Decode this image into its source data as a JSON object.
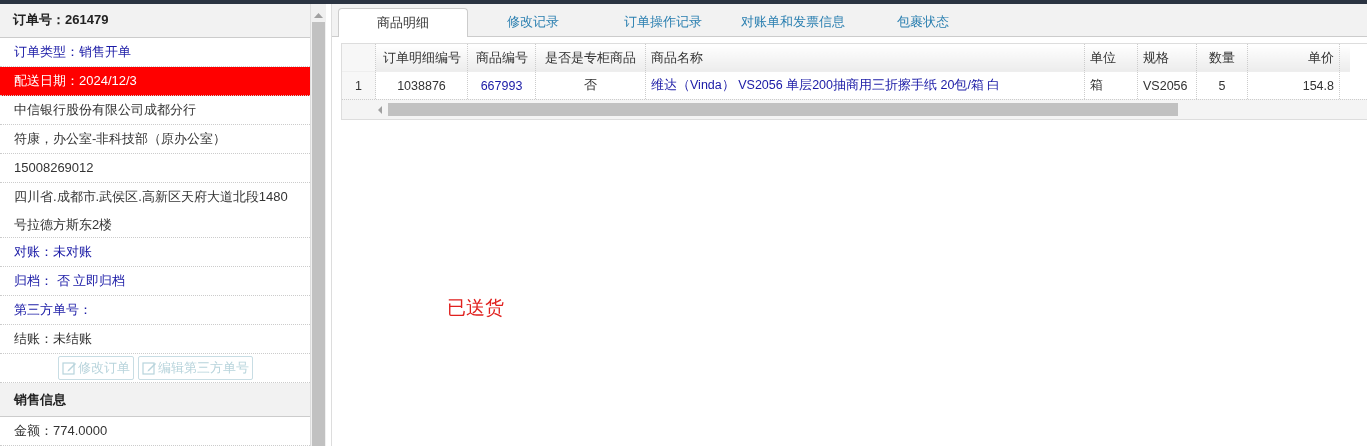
{
  "order_panel": {
    "header": "订单号：261479",
    "rows": [
      {
        "text": "订单类型：销售开单",
        "kind": "link"
      },
      {
        "text": "配送日期：2024/12/3",
        "kind": "highlight"
      },
      {
        "text": "中信银行股份有限公司成都分行",
        "kind": "plain"
      },
      {
        "text": "符康，办公室-非科技部（原办公室）",
        "kind": "plain"
      },
      {
        "text": "15008269012",
        "kind": "plain"
      },
      {
        "text": "四川省.成都市.武侯区.高新区天府大道北段1480号拉德方斯东2楼",
        "kind": "plain"
      },
      {
        "text": "对账：未对账",
        "kind": "link"
      },
      {
        "text": "归档：  否 立即归档",
        "kind": "link"
      },
      {
        "text": "第三方单号：",
        "kind": "link"
      },
      {
        "text": "结账：未结账",
        "kind": "plain"
      }
    ],
    "buttons": [
      {
        "label": "修改订单",
        "disabled": true
      },
      {
        "label": "编辑第三方单号",
        "disabled": true
      }
    ],
    "section_title": "销售信息",
    "section_rows": [
      {
        "text": "金额：774.0000"
      }
    ]
  },
  "tabs": [
    {
      "label": "商品明细",
      "selected": true
    },
    {
      "label": "修改记录",
      "selected": false
    },
    {
      "label": "订单操作记录",
      "selected": false
    },
    {
      "label": "对账单和发票信息",
      "selected": false
    },
    {
      "label": "包裹状态",
      "selected": false
    }
  ],
  "table": {
    "columns": [
      {
        "label": "订单明细编号"
      },
      {
        "label": "商品编号"
      },
      {
        "label": "是否是专柜商品"
      },
      {
        "label": "商品名称"
      },
      {
        "label": "单位"
      },
      {
        "label": "规格"
      },
      {
        "label": "数量"
      },
      {
        "label": "单价"
      }
    ],
    "rows": [
      {
        "index": "1",
        "cells": [
          {
            "text": "1038876",
            "kind": "plain"
          },
          {
            "text": "667993",
            "kind": "link"
          },
          {
            "text": "否",
            "kind": "plain"
          },
          {
            "text": "维达（Vinda） VS2056 单层200抽商用三折擦手纸 20包/箱 白",
            "kind": "link"
          },
          {
            "text": "箱",
            "kind": "plain"
          },
          {
            "text": "VS2056",
            "kind": "plain"
          },
          {
            "text": "5",
            "kind": "plain"
          },
          {
            "text": "154.8",
            "kind": "plain"
          }
        ]
      }
    ]
  },
  "status": "已送货"
}
